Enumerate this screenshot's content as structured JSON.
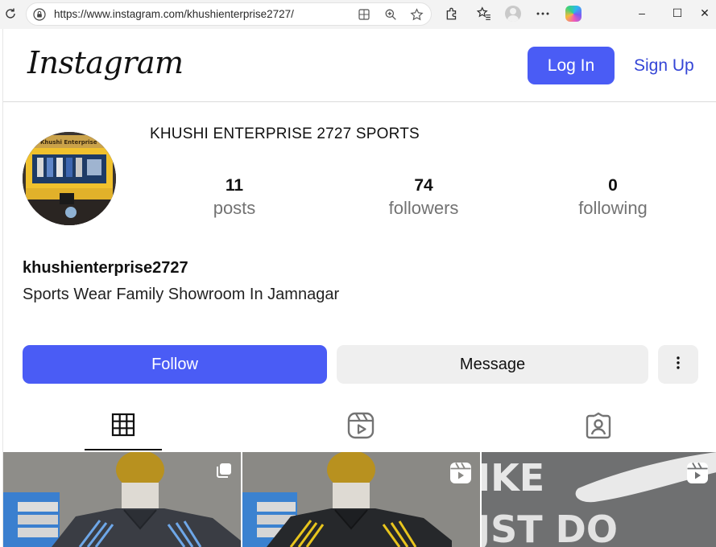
{
  "browser": {
    "url": "https://www.instagram.com/khushienterprise2727/",
    "icons": [
      "reload-icon",
      "lock-icon",
      "reading-mode-icon",
      "zoom-icon",
      "favorite-star-icon",
      "extensions-icon",
      "favorites-icon",
      "profile-icon",
      "more-icon",
      "copilot-icon"
    ],
    "window_controls": {
      "minimize": "–",
      "maximize": "☐",
      "close": "✕"
    }
  },
  "header": {
    "logo": "Instagram",
    "login_label": "Log In",
    "signup_label": "Sign Up",
    "accent": "#4a5cf5"
  },
  "profile": {
    "display_name": "KHUSHI ENTERPRISE 2727 SPORTS",
    "handle": "khushienterprise2727",
    "bio": "Sports Wear Family Showroom In Jamnagar",
    "avatar_sign_text": "Khushi Enterprise",
    "stats": [
      {
        "value": "11",
        "label": "posts"
      },
      {
        "value": "74",
        "label": "followers"
      },
      {
        "value": "0",
        "label": "following"
      }
    ],
    "follow_label": "Follow",
    "message_label": "Message",
    "more_icon": "vertical-dots-icon"
  },
  "tabs": [
    {
      "name": "posts-grid",
      "icon": "grid-icon",
      "active": true
    },
    {
      "name": "reels",
      "icon": "reels-icon",
      "active": false
    },
    {
      "name": "tagged",
      "icon": "tagged-icon",
      "active": false
    }
  ],
  "posts": [
    {
      "badge": "carousel-icon"
    },
    {
      "badge": "reel-icon"
    },
    {
      "badge": "reel-icon",
      "overlay_text": "IKE / JST DO"
    }
  ]
}
